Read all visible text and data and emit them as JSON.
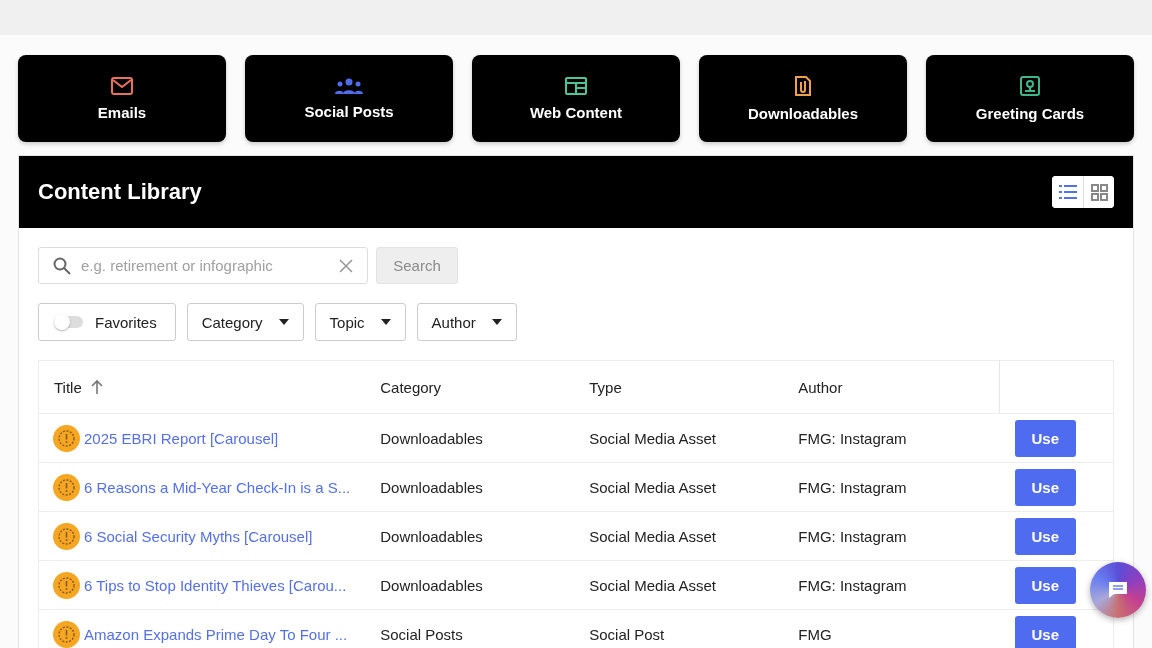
{
  "categories": [
    {
      "label": "Emails",
      "color": "#e8735a"
    },
    {
      "label": "Social Posts",
      "color": "#4f6cf0"
    },
    {
      "label": "Web Content",
      "color": "#4cc49a"
    },
    {
      "label": "Downloadables",
      "color": "#f0a04a"
    },
    {
      "label": "Greeting Cards",
      "color": "#3fb58a"
    }
  ],
  "library": {
    "title": "Content Library",
    "view_options": [
      {
        "selected": true
      },
      {
        "selected": false
      }
    ],
    "search": {
      "placeholder": "e.g. retirement or infographic",
      "button": "Search",
      "button_disabled": true
    },
    "favorites": {
      "label": "Favorites",
      "on": false
    },
    "dropdowns": [
      "Category",
      "Topic",
      "Author"
    ],
    "table": {
      "columns": [
        {
          "label": "Title",
          "sorted_ascending": true
        },
        {
          "label": "Category",
          "sorted_ascending": false
        },
        {
          "label": "Type",
          "sorted_ascending": false
        },
        {
          "label": "Author",
          "sorted_ascending": false
        }
      ],
      "rows": [
        {
          "title": "2025 EBRI Report [Carousel]",
          "category": "Downloadables",
          "type": "Social Media Asset",
          "author": "FMG: Instagram",
          "action": "Use"
        },
        {
          "title": "6 Reasons a Mid-Year Check-In is a S...",
          "category": "Downloadables",
          "type": "Social Media Asset",
          "author": "FMG: Instagram",
          "action": "Use"
        },
        {
          "title": "6 Social Security Myths [Carousel]",
          "category": "Downloadables",
          "type": "Social Media Asset",
          "author": "FMG: Instagram",
          "action": "Use"
        },
        {
          "title": "6 Tips to Stop Identity Thieves [Carou...",
          "category": "Downloadables",
          "type": "Social Media Asset",
          "author": "FMG: Instagram",
          "action": "Use"
        },
        {
          "title": "Amazon Expands Prime Day To Four ...",
          "category": "Social Posts",
          "type": "Social Post",
          "author": "FMG",
          "action": "Use"
        }
      ]
    }
  }
}
